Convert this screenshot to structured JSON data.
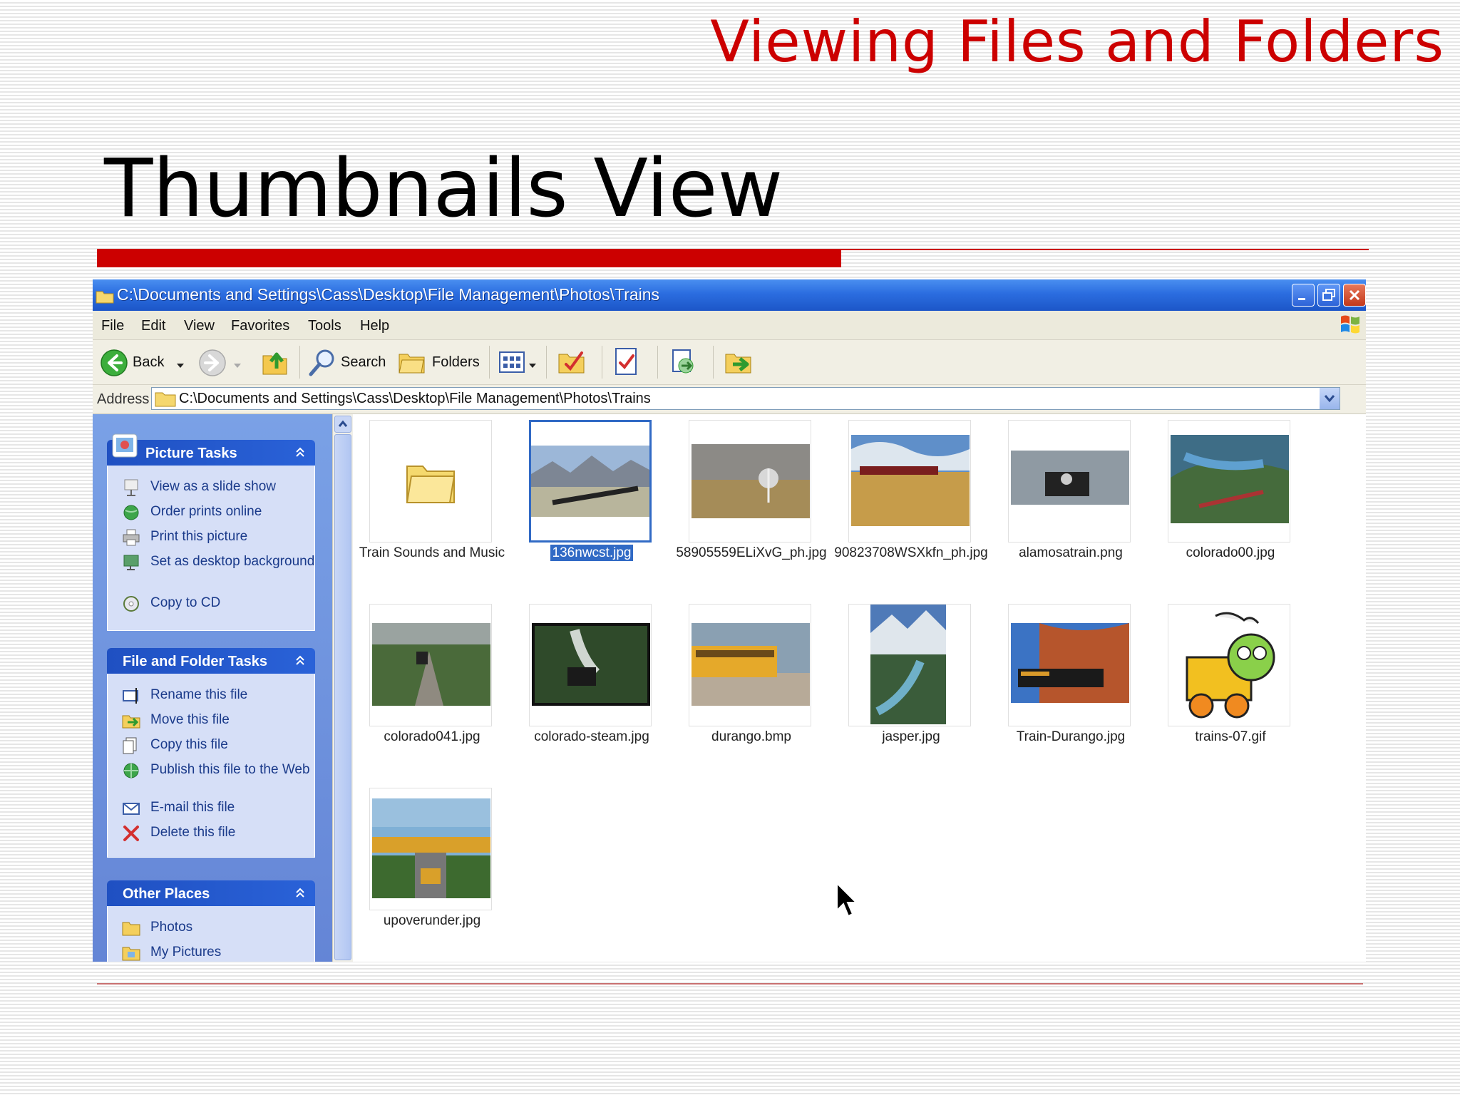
{
  "slide": {
    "header": "Viewing Files and Folders",
    "title": "Thumbnails View"
  },
  "window": {
    "title": "C:\\Documents and Settings\\Cass\\Desktop\\File Management\\Photos\\Trains",
    "menu": [
      "File",
      "Edit",
      "View",
      "Favorites",
      "Tools",
      "Help"
    ],
    "toolbar": {
      "back": "Back",
      "search": "Search",
      "folders": "Folders"
    },
    "address": {
      "label": "Address",
      "value": "C:\\Documents and Settings\\Cass\\Desktop\\File Management\\Photos\\Trains"
    }
  },
  "taskpane": {
    "picture_tasks": {
      "title": "Picture Tasks",
      "items": [
        "View as a slide show",
        "Order prints online",
        "Print this picture",
        "Set as desktop background",
        "Copy to CD"
      ]
    },
    "file_folder_tasks": {
      "title": "File and Folder Tasks",
      "items": [
        "Rename this file",
        "Move this file",
        "Copy this file",
        "Publish this file to the Web",
        "E-mail this file",
        "Delete this file"
      ]
    },
    "other_places": {
      "title": "Other Places",
      "items": [
        "Photos",
        "My Pictures"
      ]
    }
  },
  "files": [
    {
      "name": "Train Sounds and Music",
      "type": "folder"
    },
    {
      "name": "136nwcst.jpg",
      "type": "image",
      "selected": true
    },
    {
      "name": "58905559ELiXvG_ph.jpg",
      "type": "image"
    },
    {
      "name": "90823708WSXkfn_ph.jpg",
      "type": "image"
    },
    {
      "name": "alamosatrain.png",
      "type": "image"
    },
    {
      "name": "colorado00.jpg",
      "type": "image"
    },
    {
      "name": "colorado041.jpg",
      "type": "image"
    },
    {
      "name": "colorado-steam.jpg",
      "type": "image"
    },
    {
      "name": "durango.bmp",
      "type": "image"
    },
    {
      "name": "jasper.jpg",
      "type": "image"
    },
    {
      "name": "Train-Durango.jpg",
      "type": "image"
    },
    {
      "name": "trains-07.gif",
      "type": "image"
    },
    {
      "name": "upoverunder.jpg",
      "type": "image"
    }
  ],
  "colors": {
    "accent_red": "#cc0000",
    "xp_title_blue": "#2b6de0",
    "selection_blue": "#316ac5",
    "taskpane_blue": "#6f95e0"
  }
}
